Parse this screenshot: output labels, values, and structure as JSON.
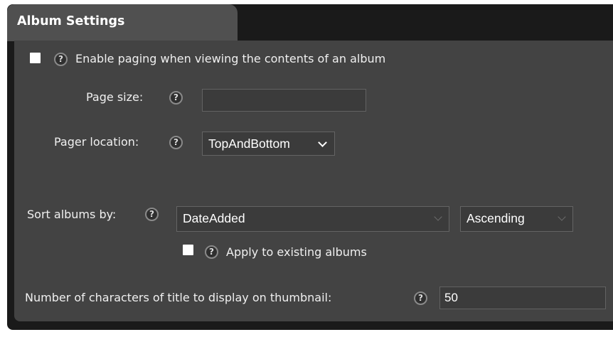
{
  "panel": {
    "title": "Album Settings"
  },
  "paging": {
    "enable_label": "Enable paging when viewing the contents of an album",
    "enable_checked": false,
    "page_size_label": "Page size:",
    "page_size_value": "",
    "pager_location_label": "Pager location:",
    "pager_location_value": "TopAndBottom"
  },
  "sort": {
    "label": "Sort albums by:",
    "field_value": "DateAdded",
    "direction_value": "Ascending",
    "apply_label": "Apply to existing albums",
    "apply_checked": false
  },
  "thumbnail": {
    "label": "Number of characters of title to display on thumbnail:",
    "value": "50"
  },
  "help_glyph": "?",
  "icons": [
    "help-icon",
    "chevron-down-icon",
    "checkbox"
  ],
  "colors": {
    "panel_bg": "#434343",
    "tab_bg": "#505050",
    "frame": "#1a1a1a"
  }
}
